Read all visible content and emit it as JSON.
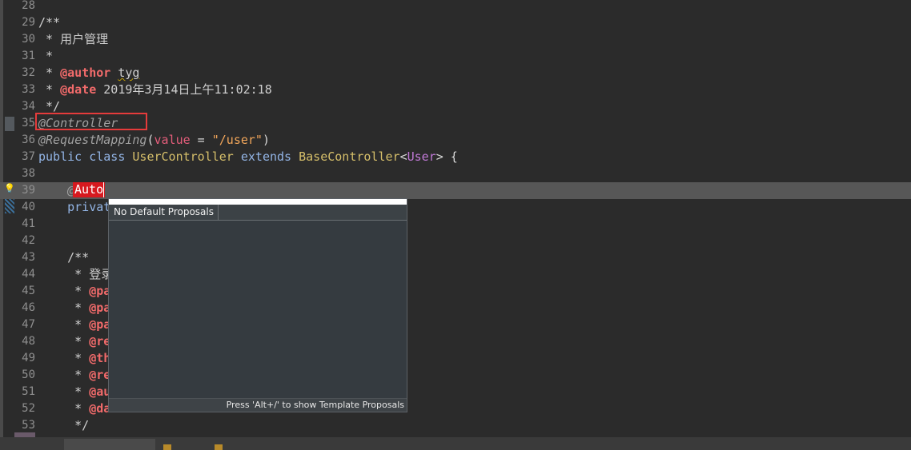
{
  "editor": {
    "lines": [
      {
        "num": "28",
        "segments": []
      },
      {
        "num": "29",
        "segments": [
          {
            "t": "/**",
            "c": "cmt"
          }
        ]
      },
      {
        "num": "30",
        "segments": [
          {
            "t": " * 用户管理",
            "c": "cmt"
          }
        ]
      },
      {
        "num": "31",
        "segments": [
          {
            "t": " *",
            "c": "cmt"
          }
        ]
      },
      {
        "num": "32",
        "segments": [
          {
            "t": " * ",
            "c": "cmt"
          },
          {
            "t": "@author",
            "c": "tag"
          },
          {
            "t": " ",
            "c": "cmt"
          },
          {
            "t": "tyg",
            "c": "cmt under"
          }
        ]
      },
      {
        "num": "33",
        "segments": [
          {
            "t": " * ",
            "c": "cmt"
          },
          {
            "t": "@date",
            "c": "tag"
          },
          {
            "t": " 2019年3月14日上午11:02:18",
            "c": "cmt"
          }
        ]
      },
      {
        "num": "34",
        "segments": [
          {
            "t": " */",
            "c": "cmt"
          }
        ]
      },
      {
        "num": "35",
        "segments": [
          {
            "t": "@Controller",
            "c": "ann"
          }
        ]
      },
      {
        "num": "36",
        "segments": [
          {
            "t": "@RequestMapping",
            "c": "ann"
          },
          {
            "t": "(",
            "c": ""
          },
          {
            "t": "value",
            "c": "attr"
          },
          {
            "t": " = ",
            "c": ""
          },
          {
            "t": "\"/user\"",
            "c": "str"
          },
          {
            "t": ")",
            "c": ""
          }
        ]
      },
      {
        "num": "37",
        "segments": [
          {
            "t": "public",
            "c": "kw"
          },
          {
            "t": " ",
            "c": ""
          },
          {
            "t": "class",
            "c": "kw"
          },
          {
            "t": " ",
            "c": ""
          },
          {
            "t": "UserController",
            "c": "cls"
          },
          {
            "t": " ",
            "c": ""
          },
          {
            "t": "extends",
            "c": "kw"
          },
          {
            "t": " ",
            "c": ""
          },
          {
            "t": "BaseController",
            "c": "cls"
          },
          {
            "t": "<",
            "c": ""
          },
          {
            "t": "User",
            "c": "gen"
          },
          {
            "t": "> {",
            "c": ""
          }
        ]
      },
      {
        "num": "38",
        "segments": []
      },
      {
        "num": "39",
        "segments": [
          {
            "t": "    @",
            "c": "ann"
          }
        ]
      },
      {
        "num": "40",
        "segments": [
          {
            "t": "    ",
            "c": ""
          },
          {
            "t": "privat",
            "c": "kw"
          }
        ]
      },
      {
        "num": "41",
        "segments": []
      },
      {
        "num": "42",
        "segments": []
      },
      {
        "num": "43",
        "segments": [
          {
            "t": "    /**",
            "c": "cmt"
          }
        ]
      },
      {
        "num": "44",
        "segments": [
          {
            "t": "     * 登录",
            "c": "cmt"
          }
        ]
      },
      {
        "num": "45",
        "segments": [
          {
            "t": "     * ",
            "c": "cmt"
          },
          {
            "t": "@pa",
            "c": "tag"
          }
        ]
      },
      {
        "num": "46",
        "segments": [
          {
            "t": "     * ",
            "c": "cmt"
          },
          {
            "t": "@pa",
            "c": "tag"
          }
        ]
      },
      {
        "num": "47",
        "segments": [
          {
            "t": "     * ",
            "c": "cmt"
          },
          {
            "t": "@pa",
            "c": "tag"
          }
        ]
      },
      {
        "num": "48",
        "segments": [
          {
            "t": "     * ",
            "c": "cmt"
          },
          {
            "t": "@re",
            "c": "tag"
          }
        ]
      },
      {
        "num": "49",
        "segments": [
          {
            "t": "     * ",
            "c": "cmt"
          },
          {
            "t": "@th",
            "c": "tag"
          }
        ]
      },
      {
        "num": "50",
        "segments": [
          {
            "t": "     * ",
            "c": "cmt"
          },
          {
            "t": "@re",
            "c": "tag"
          }
        ]
      },
      {
        "num": "51",
        "segments": [
          {
            "t": "     * ",
            "c": "cmt"
          },
          {
            "t": "@au",
            "c": "tag"
          }
        ]
      },
      {
        "num": "52",
        "segments": [
          {
            "t": "     * ",
            "c": "cmt"
          },
          {
            "t": "@da",
            "c": "tag"
          }
        ]
      },
      {
        "num": "53",
        "segments": [
          {
            "t": "     */",
            "c": "cmt"
          }
        ]
      }
    ],
    "current_line": "39",
    "typed_text": "Auto"
  },
  "popup": {
    "title": "No Default Proposals",
    "hint": "Press 'Alt+/' to show Template Proposals"
  },
  "icons": {
    "error_marker": "quick-fix-error-icon"
  },
  "colors": {
    "background": "#2b2b2b",
    "highlight_box": "#e53b3b",
    "typed_highlight": "#d7191f"
  }
}
